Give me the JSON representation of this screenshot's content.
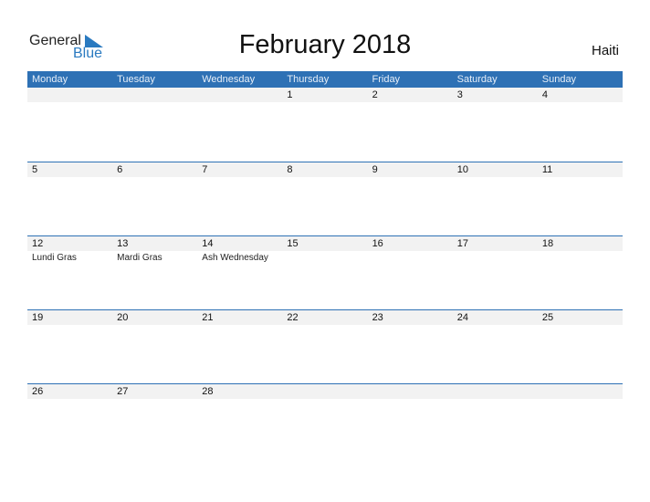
{
  "logo": {
    "text1": "General",
    "text2": "Blue"
  },
  "title": "February 2018",
  "country": "Haiti",
  "colors": {
    "accent": "#2e71b5",
    "strip": "#f2f2f2"
  },
  "weekdays": [
    "Monday",
    "Tuesday",
    "Wednesday",
    "Thursday",
    "Friday",
    "Saturday",
    "Sunday"
  ],
  "weeks": [
    {
      "days": [
        {
          "num": "",
          "event": ""
        },
        {
          "num": "",
          "event": ""
        },
        {
          "num": "",
          "event": ""
        },
        {
          "num": "1",
          "event": ""
        },
        {
          "num": "2",
          "event": ""
        },
        {
          "num": "3",
          "event": ""
        },
        {
          "num": "4",
          "event": ""
        }
      ]
    },
    {
      "days": [
        {
          "num": "5",
          "event": ""
        },
        {
          "num": "6",
          "event": ""
        },
        {
          "num": "7",
          "event": ""
        },
        {
          "num": "8",
          "event": ""
        },
        {
          "num": "9",
          "event": ""
        },
        {
          "num": "10",
          "event": ""
        },
        {
          "num": "11",
          "event": ""
        }
      ]
    },
    {
      "days": [
        {
          "num": "12",
          "event": "Lundi Gras"
        },
        {
          "num": "13",
          "event": "Mardi Gras"
        },
        {
          "num": "14",
          "event": "Ash Wednesday"
        },
        {
          "num": "15",
          "event": ""
        },
        {
          "num": "16",
          "event": ""
        },
        {
          "num": "17",
          "event": ""
        },
        {
          "num": "18",
          "event": ""
        }
      ]
    },
    {
      "days": [
        {
          "num": "19",
          "event": ""
        },
        {
          "num": "20",
          "event": ""
        },
        {
          "num": "21",
          "event": ""
        },
        {
          "num": "22",
          "event": ""
        },
        {
          "num": "23",
          "event": ""
        },
        {
          "num": "24",
          "event": ""
        },
        {
          "num": "25",
          "event": ""
        }
      ]
    },
    {
      "days": [
        {
          "num": "26",
          "event": ""
        },
        {
          "num": "27",
          "event": ""
        },
        {
          "num": "28",
          "event": ""
        },
        {
          "num": "",
          "event": ""
        },
        {
          "num": "",
          "event": ""
        },
        {
          "num": "",
          "event": ""
        },
        {
          "num": "",
          "event": ""
        }
      ]
    }
  ]
}
